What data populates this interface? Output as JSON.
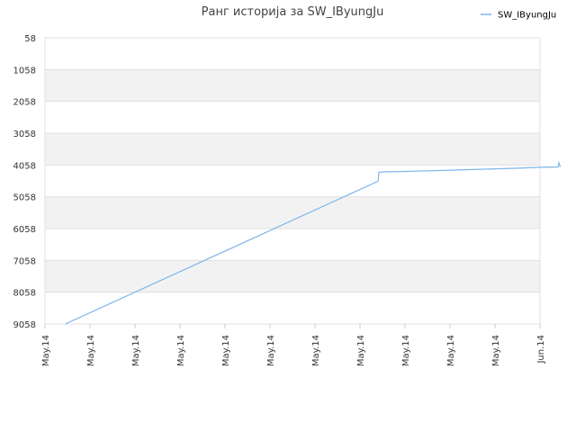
{
  "chart_data": {
    "type": "line",
    "title": "Ранг историја за SW_IByungJu",
    "xlabel": "",
    "ylabel": "",
    "y_reversed": true,
    "ylim": [
      58,
      9058
    ],
    "y_ticks": [
      "58",
      "1058",
      "2058",
      "3058",
      "4058",
      "5058",
      "6058",
      "7058",
      "8058",
      "9058"
    ],
    "x_ticks": [
      "May.14",
      "May.14",
      "May.14",
      "May.14",
      "May.14",
      "May.14",
      "May.14",
      "May.14",
      "May.14",
      "May.14",
      "May.14",
      "Jun.14"
    ],
    "grid": true,
    "alternating_bands": true,
    "legend": {
      "position": "top-right",
      "entries": [
        "SW_IByungJu"
      ]
    },
    "series": [
      {
        "name": "SW_IByungJu",
        "color": "#7cb5ec",
        "points": [
          [
            0.45,
            9058
          ],
          [
            7.4,
            4570
          ],
          [
            7.42,
            4290
          ],
          [
            7.5,
            4275
          ],
          [
            8.0,
            4260
          ],
          [
            8.5,
            4240
          ],
          [
            9.0,
            4220
          ],
          [
            9.5,
            4200
          ],
          [
            10.0,
            4180
          ],
          [
            10.5,
            4160
          ],
          [
            11.0,
            4130
          ],
          [
            11.4,
            4120
          ],
          [
            11.42,
            3990
          ],
          [
            11.45,
            4120
          ]
        ]
      }
    ]
  }
}
